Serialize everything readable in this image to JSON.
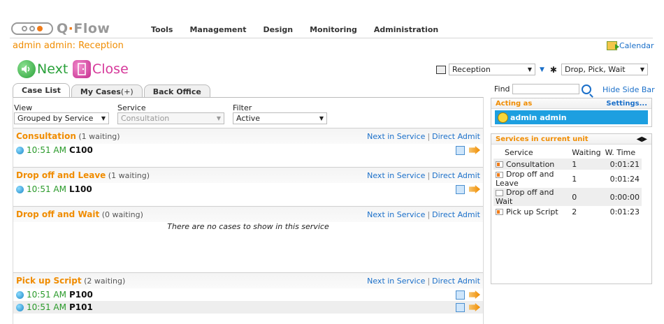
{
  "app": {
    "logo": "Q·Flow"
  },
  "nav": [
    "Tools",
    "Management",
    "Design",
    "Monitoring",
    "Administration"
  ],
  "heading": "admin admin: Reception",
  "calendar_label": "Calendar",
  "actions": {
    "next": "Next",
    "close": "Close"
  },
  "unit": {
    "selected": "Reception",
    "profile": "Drop, Pick, Wait"
  },
  "tabs": {
    "case_list": "Case List",
    "my_cases": "My Cases",
    "my_cases_suffix": "(+)",
    "back_office": "Back Office"
  },
  "filters": {
    "view_label": "View",
    "view_value": "Grouped by Service",
    "service_label": "Service",
    "service_value": "Consultation",
    "filter_label": "Filter",
    "filter_value": "Active"
  },
  "link_next": "Next in Service",
  "link_direct": "Direct Admit",
  "services": [
    {
      "name": "Consultation",
      "count": "(1 waiting)",
      "cases": [
        {
          "time": "10:51 AM",
          "id": "C100"
        }
      ]
    },
    {
      "name": "Drop off and Leave",
      "count": "(1 waiting)",
      "cases": [
        {
          "time": "10:51 AM",
          "id": "L100"
        }
      ]
    },
    {
      "name": "Drop off and Wait",
      "count": "(0 waiting)",
      "empty": "There are no cases to show in this service",
      "cases": []
    },
    {
      "name": "Pick up Script",
      "count": "(2 waiting)",
      "cases": [
        {
          "time": "10:51 AM",
          "id": "P100"
        },
        {
          "time": "10:51 AM",
          "id": "P101"
        }
      ]
    }
  ],
  "sidebar": {
    "find_label": "Find",
    "hide_label": "Hide Side Bar",
    "acting_as_label": "Acting as",
    "settings_label": "Settings...",
    "acting_user": "admin admin",
    "unit_services_title": "Services in current unit",
    "col_service": "Service",
    "col_waiting": "Waiting",
    "col_wtime": "W. Time",
    "rows": [
      {
        "service": "Consultation",
        "waiting": "1",
        "wtime": "0:01:21",
        "active": true
      },
      {
        "service": "Drop off and Leave",
        "waiting": "1",
        "wtime": "0:01:24",
        "active": true
      },
      {
        "service": "Drop off and Wait",
        "waiting": "0",
        "wtime": "0:00:00",
        "active": false
      },
      {
        "service": "Pick up Script",
        "waiting": "2",
        "wtime": "0:01:23",
        "active": true
      }
    ]
  }
}
